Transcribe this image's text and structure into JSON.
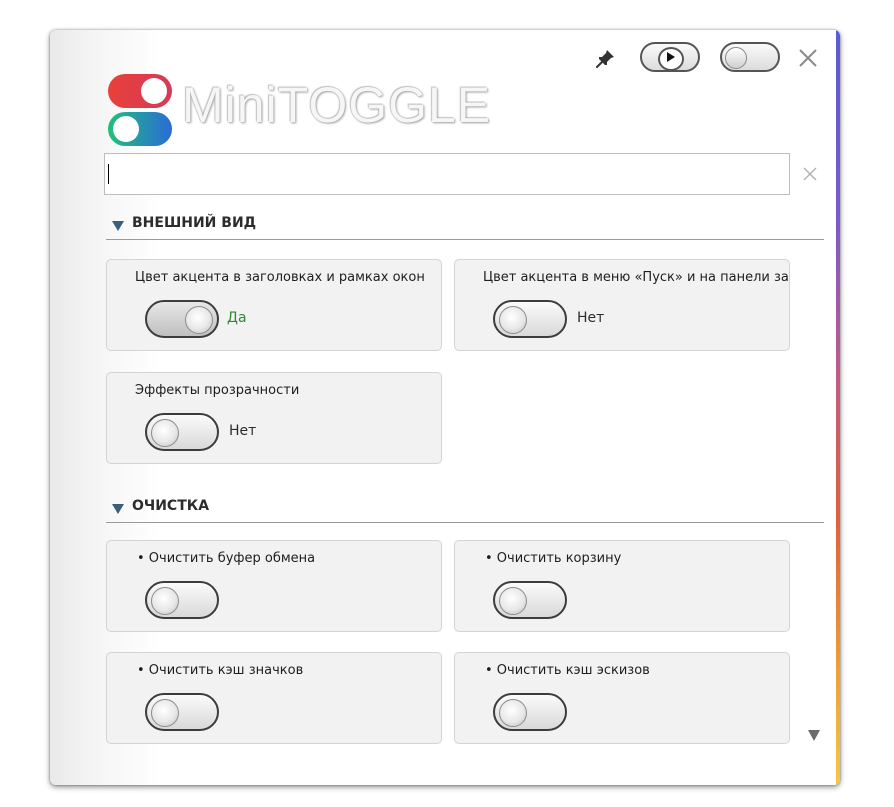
{
  "app": {
    "title": "MiniTOGGLE"
  },
  "titlebar": {
    "pin_icon": "pin-icon",
    "play_icon": "play-icon",
    "close_icon": "close-icon"
  },
  "search": {
    "value": "",
    "placeholder": ""
  },
  "sections": [
    {
      "title": "ВНЕШНИЙ ВИД",
      "cards": [
        {
          "title": "Цвет акцента в заголовках и рамках окон",
          "state_label": "Да",
          "enabled": true
        },
        {
          "title": "Цвет акцента в меню «Пуск» и на панели задач",
          "state_label": "Нет",
          "enabled": false
        },
        {
          "title": "Эффекты прозрачности",
          "state_label": "Нет",
          "enabled": false
        }
      ]
    },
    {
      "title": "ОЧИСТКА",
      "cards": [
        {
          "title": "• Очистить буфер обмена",
          "enabled": false
        },
        {
          "title": "• Очистить корзину",
          "enabled": false
        },
        {
          "title": "• Очистить кэш значков",
          "enabled": false
        },
        {
          "title": "• Очистить кэш эскизов",
          "enabled": false
        }
      ]
    }
  ],
  "colors": {
    "logo_red": "#e8403a",
    "logo_green": "#22c07a",
    "logo_blue": "#2a6bd8",
    "on_state": "#2d8a2d",
    "section_arrow": "#3a5f7c"
  }
}
